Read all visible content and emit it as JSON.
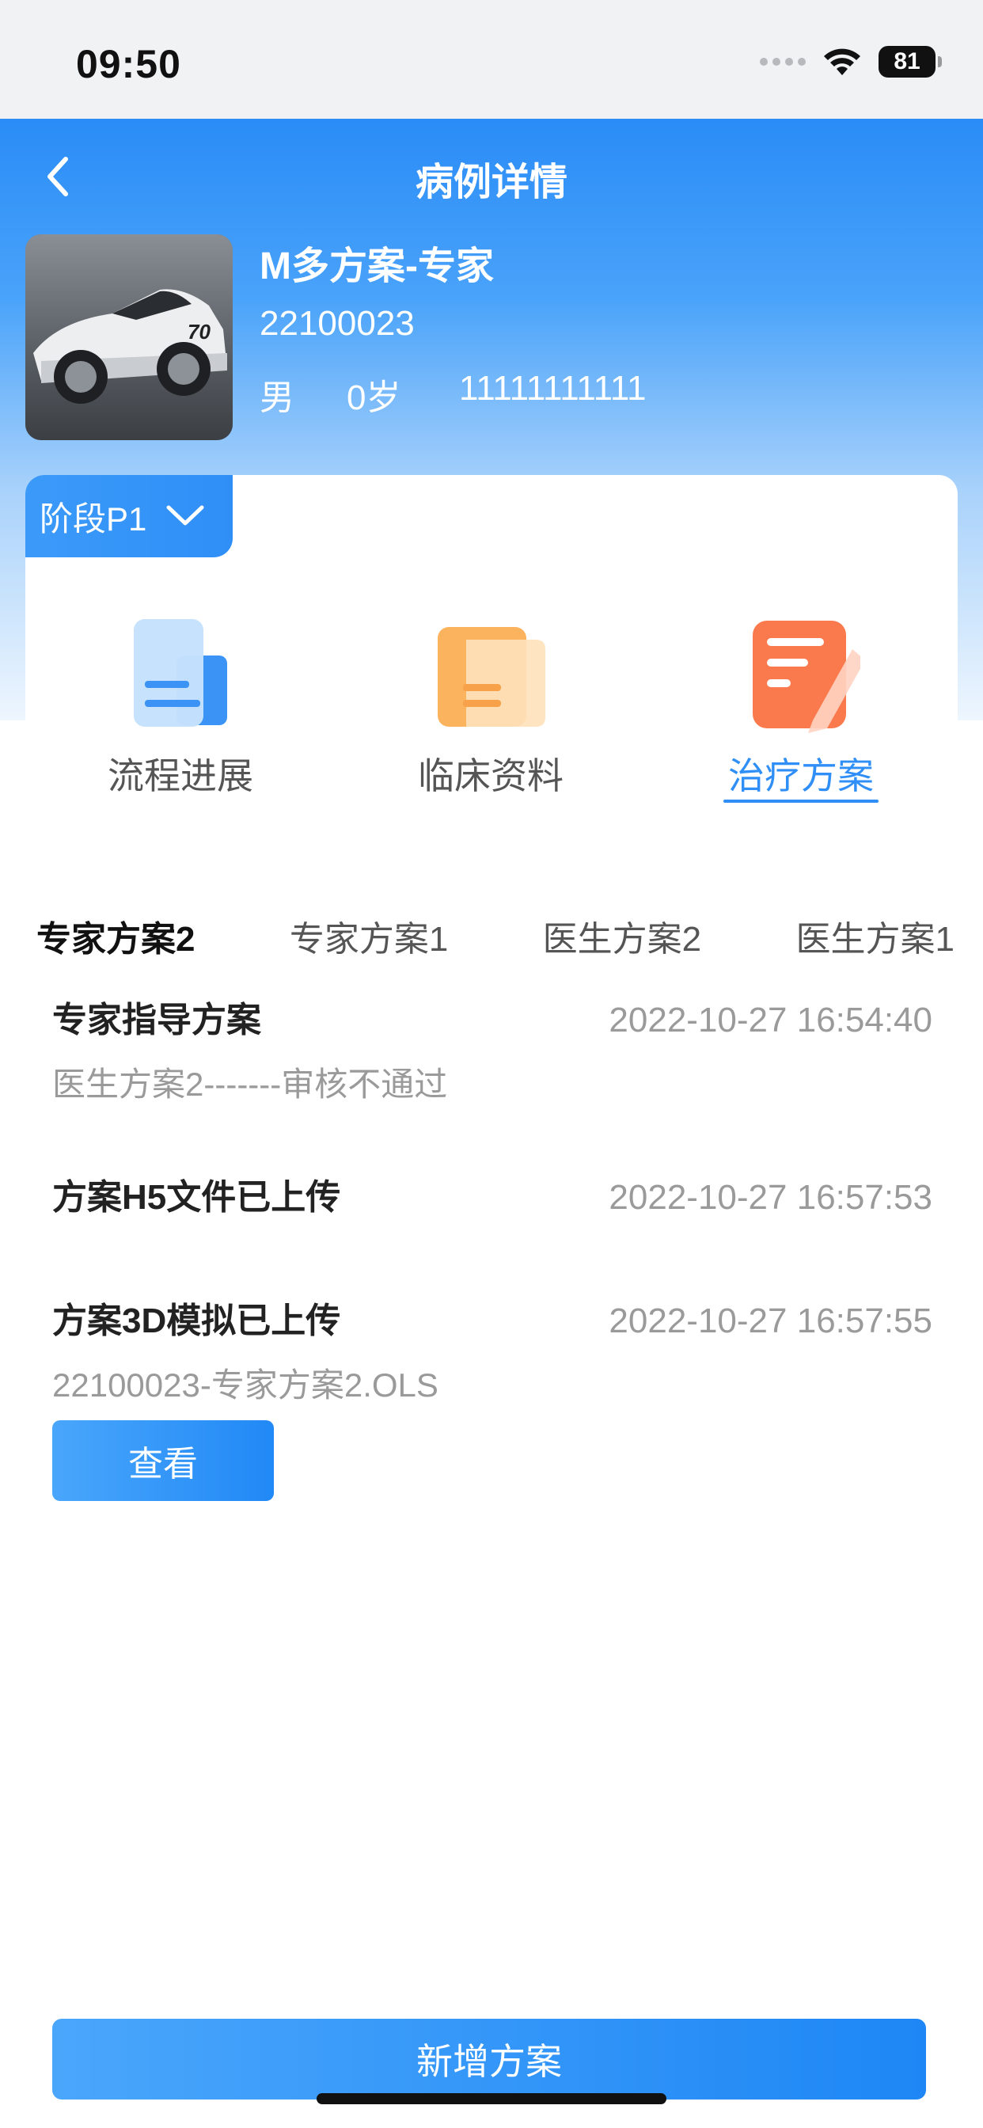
{
  "status_bar": {
    "time": "09:50",
    "battery": "81"
  },
  "header": {
    "title": "病例详情"
  },
  "patient": {
    "name": "M多方案-专家",
    "case_id": "22100023",
    "gender": "男",
    "age": "0岁",
    "phone": "11111111111"
  },
  "stage": {
    "label": "阶段P1"
  },
  "features": [
    {
      "label": "流程进展",
      "icon": "document-icon",
      "active": false
    },
    {
      "label": "临床资料",
      "icon": "folder-icon",
      "active": false
    },
    {
      "label": "治疗方案",
      "icon": "note-edit-icon",
      "active": true
    }
  ],
  "plan_tabs": [
    {
      "label": "专家方案2",
      "active": true
    },
    {
      "label": "专家方案1",
      "active": false
    },
    {
      "label": "医生方案2",
      "active": false
    },
    {
      "label": "医生方案1",
      "active": false
    }
  ],
  "records": [
    {
      "title": "专家指导方案",
      "time": "2022-10-27 16:54:40",
      "desc": "医生方案2-------审核不通过"
    },
    {
      "title": "方案H5文件已上传",
      "time": "2022-10-27 16:57:53",
      "desc": ""
    },
    {
      "title": "方案3D模拟已上传",
      "time": "2022-10-27 16:57:55",
      "desc": "22100023-专家方案2.OLS"
    }
  ],
  "buttons": {
    "view": "查看",
    "add_plan": "新增方案"
  },
  "colors": {
    "primary": "#2f8ff7",
    "header_top": "#2a8cf7",
    "muted_text": "#9a9a9a"
  }
}
